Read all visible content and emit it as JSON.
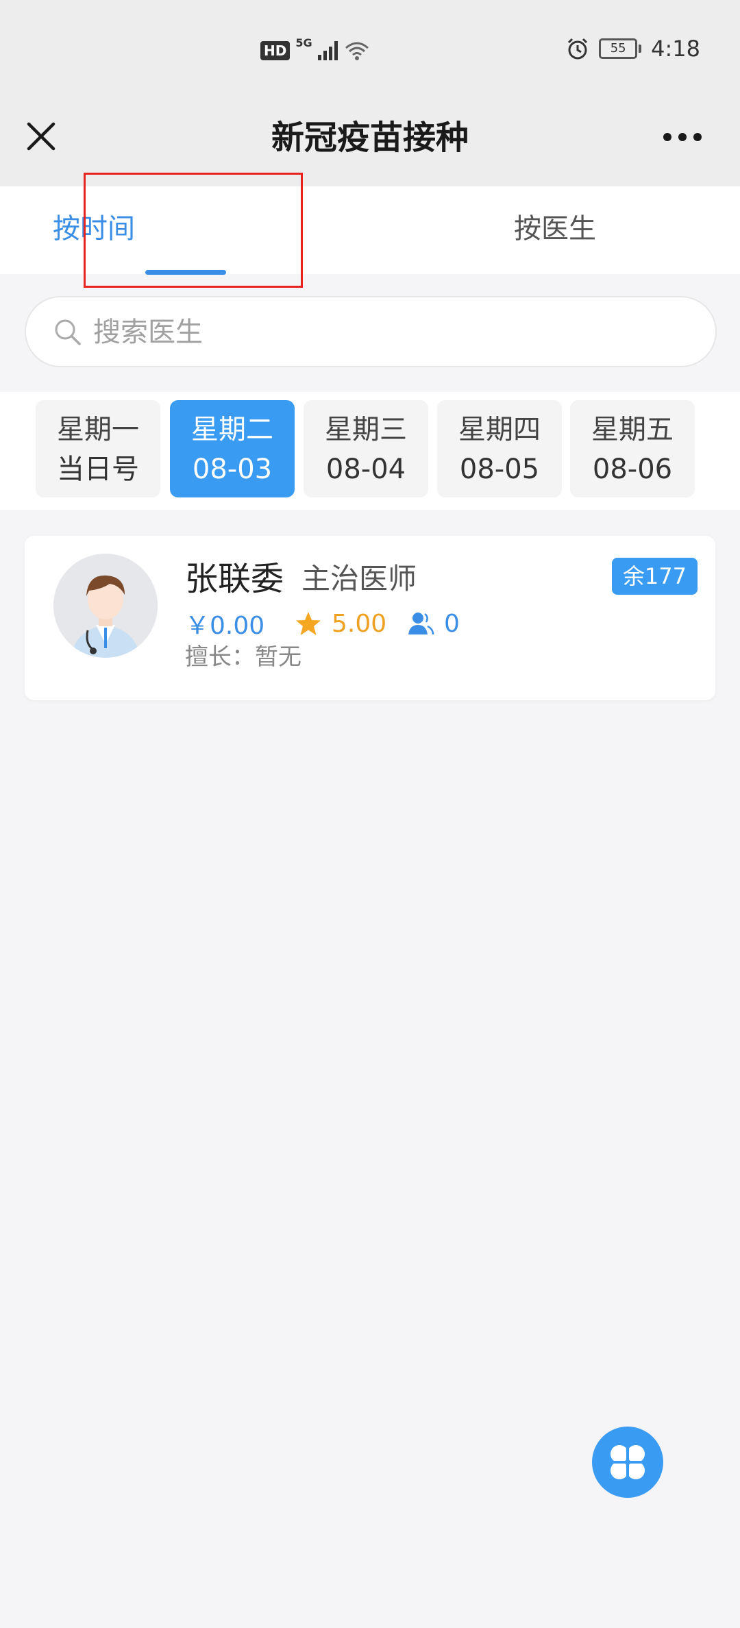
{
  "status_bar": {
    "hd": "HD",
    "network": "5G",
    "battery": "55",
    "time": "4:18"
  },
  "nav": {
    "title": "新冠疫苗接种"
  },
  "tabs": [
    {
      "label": "按时间",
      "active": true
    },
    {
      "label": "按医生",
      "active": false
    }
  ],
  "search": {
    "placeholder": "搜索医生",
    "value": ""
  },
  "dates": [
    {
      "week": "星期一",
      "date": "当日号",
      "active": false
    },
    {
      "week": "星期二",
      "date": "08-03",
      "active": true
    },
    {
      "week": "星期三",
      "date": "08-04",
      "active": false
    },
    {
      "week": "星期四",
      "date": "08-05",
      "active": false
    },
    {
      "week": "星期五",
      "date": "08-06",
      "active": false
    }
  ],
  "doctors": [
    {
      "name": "张联委",
      "title": "主治医师",
      "remaining": "余177",
      "price": "￥0.00",
      "rating": "5.00",
      "consults": "0",
      "specialty": "擅长：暂无"
    }
  ],
  "colors": {
    "accent": "#3a9bf2",
    "highlight_box": "#e8231f",
    "rating": "#f0a020"
  }
}
